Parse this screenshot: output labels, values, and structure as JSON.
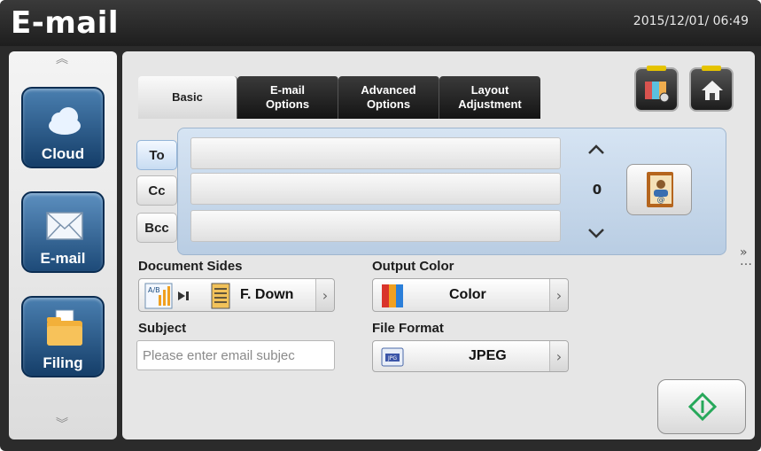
{
  "header": {
    "title": "E-mail",
    "datetime": "2015/12/01/ 06:49"
  },
  "sidebar": {
    "items": [
      {
        "label": "Cloud",
        "icon": "cloud-icon"
      },
      {
        "label": "E-mail",
        "icon": "envelope-icon"
      },
      {
        "label": "Filing",
        "icon": "folder-icon"
      }
    ]
  },
  "tabs": [
    {
      "label": "Basic",
      "active": true
    },
    {
      "label": "E-mail\nOptions",
      "active": false
    },
    {
      "label": "Advanced\nOptions",
      "active": false
    },
    {
      "label": "Layout\nAdjustment",
      "active": false
    }
  ],
  "corner_buttons": [
    {
      "icon": "scan-settings-icon"
    },
    {
      "icon": "home-icon"
    }
  ],
  "recipients": {
    "to_label": "To",
    "cc_label": "Cc",
    "bcc_label": "Bcc",
    "to_value": "",
    "cc_value": "",
    "bcc_value": "",
    "count": "0",
    "address_book_icon": "address-book-icon"
  },
  "document_sides": {
    "label": "Document Sides",
    "value": "F. Down",
    "mode_badge": "A/B"
  },
  "output_color": {
    "label": "Output Color",
    "value": "Color"
  },
  "subject": {
    "label": "Subject",
    "placeholder": "Please enter email subjec",
    "value": ""
  },
  "file_format": {
    "label": "File Format",
    "value": "JPEG",
    "badge": "JPG"
  },
  "colors": {
    "accent_blue": "#1f4f80",
    "start_green": "#27a85a",
    "highlight_yellow": "#e5c300"
  }
}
